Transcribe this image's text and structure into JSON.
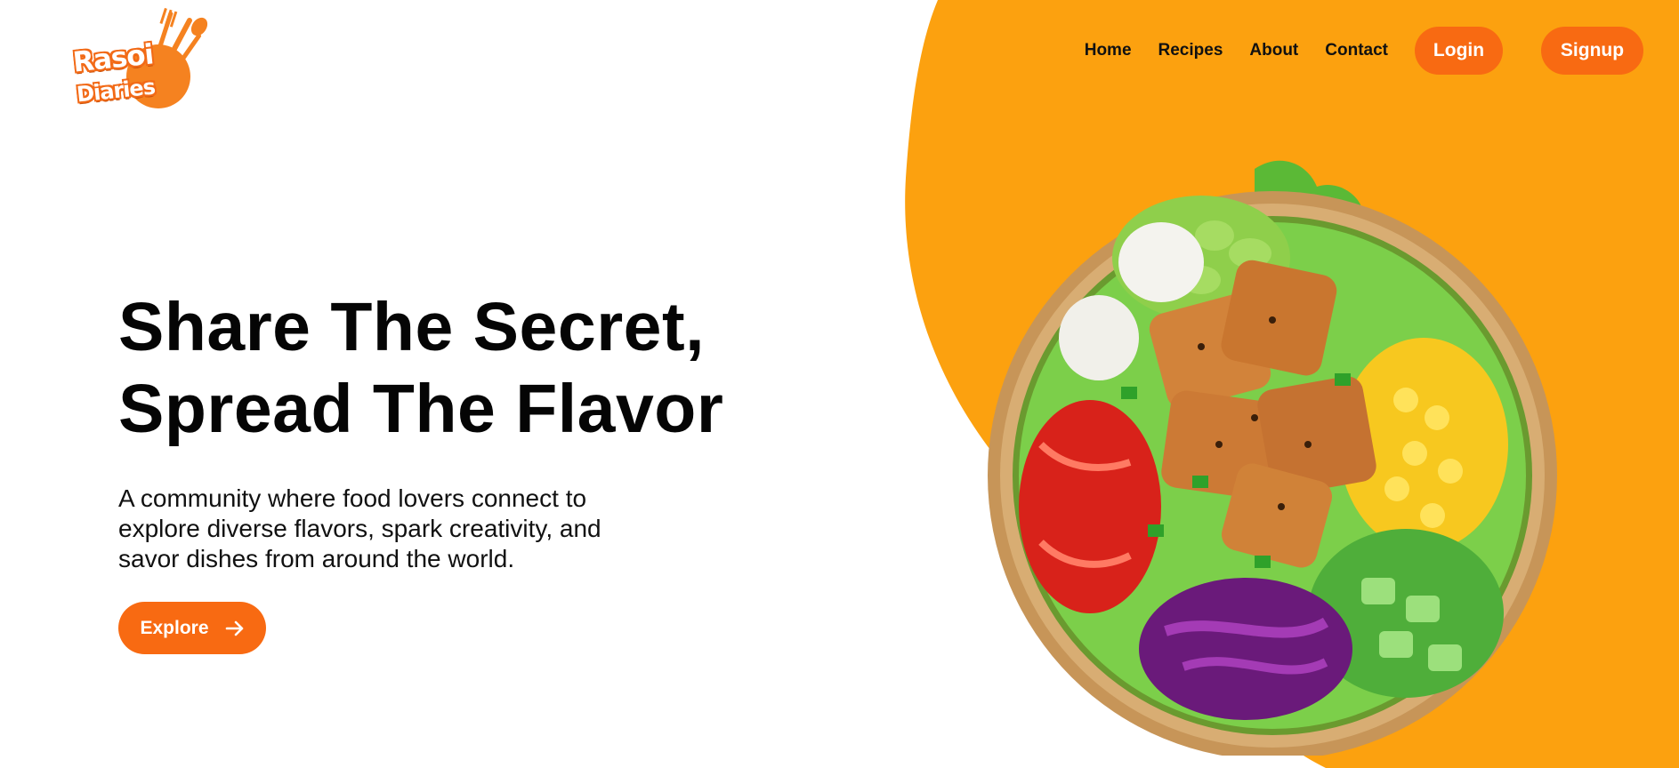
{
  "brand": {
    "line1": "Rasoi",
    "line2": "Diaries"
  },
  "nav": {
    "links": [
      "Home",
      "Recipes",
      "About",
      "Contact"
    ],
    "login_label": "Login",
    "signup_label": "Signup"
  },
  "hero": {
    "title_line1": "Share The Secret,",
    "title_line2": "Spread The Flavor",
    "description_line1": "A community where food lovers connect to",
    "description_line2": "explore diverse flavors, spark creativity, and",
    "description_line3": "savor dishes from around the world.",
    "cta_label": "Explore",
    "cta_icon": "arrow-right-icon"
  },
  "image": {
    "subject": "salad-bowl-illustration"
  },
  "colors": {
    "accent": "#f86a12",
    "background_blob": "#fca10f",
    "text": "#000000"
  }
}
